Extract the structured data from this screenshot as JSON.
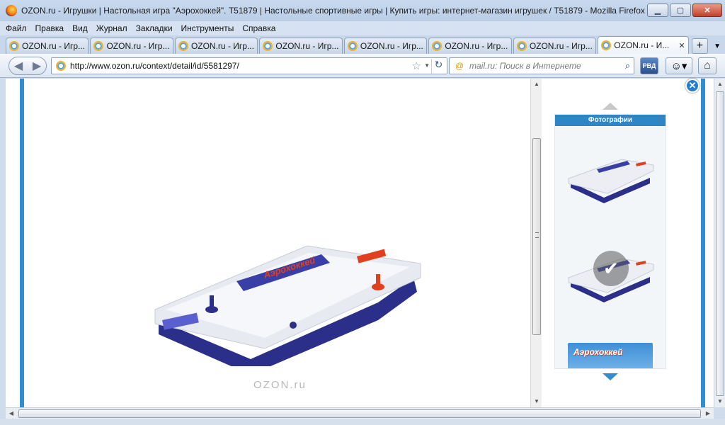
{
  "window": {
    "title": "OZON.ru - Игрушки | Настольная игра \"Аэрохоккей\". T51879 | Настольные спортивные игры | Купить игры: интернет-магазин игрушек / T51879 - Mozilla Firefox",
    "minimize": "▁",
    "maximize": "▢",
    "close": "✕"
  },
  "menu": [
    "Файл",
    "Правка",
    "Вид",
    "Журнал",
    "Закладки",
    "Инструменты",
    "Справка"
  ],
  "tabs": [
    {
      "label": "OZON.ru - Игр..."
    },
    {
      "label": "OZON.ru - Игр..."
    },
    {
      "label": "OZON.ru - Игр..."
    },
    {
      "label": "OZON.ru - Игр..."
    },
    {
      "label": "OZON.ru - Игр..."
    },
    {
      "label": "OZON.ru - Игр..."
    },
    {
      "label": "OZON.ru - Игр..."
    },
    {
      "label": "OZON.ru - И...",
      "active": true
    }
  ],
  "tab_close": "✕",
  "tab_add": "+",
  "tab_list": "▼",
  "nav": {
    "back": "◀",
    "forward": "▶",
    "url": "http://www.ozon.ru/context/detail/id/5581297/",
    "star": "☆",
    "dropdown": "▼",
    "reload": "↻",
    "search_engine": "@",
    "search_placeholder": "mail.ru: Поиск в Интернете",
    "search_go": "⌕",
    "rvd": "РВД",
    "smile": "☺▾",
    "home": "⌂"
  },
  "content": {
    "watermark": "OZON.ru",
    "close_x": "✕",
    "photos_header": "Фотографии",
    "check": "✔",
    "box_title": "Аэрохоккей",
    "product_sign": "Аэрохоккей"
  },
  "scroll": {
    "up": "▲",
    "down": "▼",
    "left": "◀",
    "right": "▶"
  },
  "colors": {
    "accent": "#2d8fd0",
    "table_body": "#2c2f8a",
    "table_top": "#f4f5f8",
    "mallet_red": "#e0401e"
  }
}
